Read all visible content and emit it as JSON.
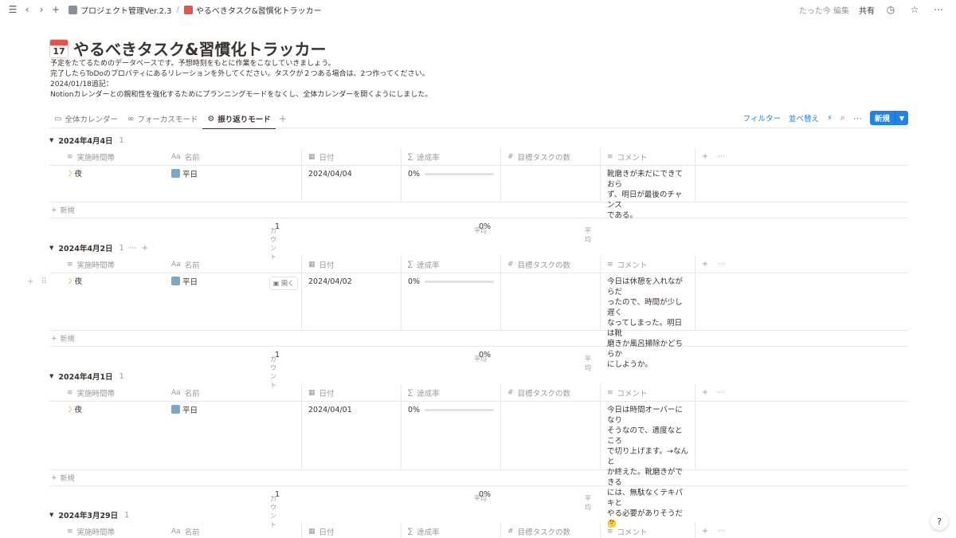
{
  "breadcrumb": {
    "parent": "プロジェクト管理Ver.2.3",
    "current": "やるべきタスク&習慣化トラッカー",
    "separator": "/"
  },
  "topbar": {
    "edited": "たった今 編集",
    "share": "共有"
  },
  "page": {
    "title": "やるべきタスク&習慣化トラッカー",
    "icon_day": "17",
    "description": [
      "予定をたてるためのデータベースです。予想時刻をもとに作業をこなしていきましょう。",
      "完了したらToDoのプロパティにあるリレーションを外してください。タスクが２つある場合は、2つ作ってください。",
      "2024/01/18追記：",
      "Notionカレンダーとの親和性を強化するためにプランニングモードをなくし、全体カレンダーを開くようにしました。"
    ]
  },
  "views": [
    {
      "label": "全体カレンダー",
      "icon": "calendar-icon"
    },
    {
      "label": "フォーカスモード",
      "icon": "glasses-icon"
    },
    {
      "label": "振り返りモード",
      "icon": "gear-icon"
    }
  ],
  "toolbar": {
    "filter": "フィルター",
    "sort": "並べ替え",
    "new": "新規"
  },
  "columns": {
    "time": "実施時間帯",
    "name": "名前",
    "date": "日付",
    "rate": "達成率",
    "goal": "目標タスクの数",
    "comment": "コメント"
  },
  "labels": {
    "new_row": "新規",
    "count": "カウント",
    "avg": "平均",
    "open": "開く"
  },
  "groups": [
    {
      "title": "2024年4月4日",
      "count": "1",
      "row": {
        "time": "夜",
        "name": "平日",
        "date": "2024/04/04",
        "rate": "0%",
        "rate_value": 0,
        "comment": [
          "靴磨きが未だにできておら",
          "ず、明日が最後のチャンス",
          "である。"
        ]
      },
      "calc": {
        "count": "1",
        "avg": "0%"
      }
    },
    {
      "title": "2024年4月2日",
      "count": "1",
      "row": {
        "time": "夜",
        "name": "平日",
        "date": "2024/04/02",
        "rate": "0%",
        "rate_value": 0,
        "comment": [
          "今日は休憩を入れながらだ",
          "ったので、時間が少し遅く",
          "なってしまった。明日は靴",
          "磨きか風呂掃除かどちらか",
          "にしようか。"
        ]
      },
      "calc": {
        "count": "1",
        "avg": "0%"
      }
    },
    {
      "title": "2024年4月1日",
      "count": "1",
      "row": {
        "time": "夜",
        "name": "平日",
        "date": "2024/04/01",
        "rate": "0%",
        "rate_value": 0,
        "comment": [
          "今日は時間オーバーになり",
          "そうなので、適度なところ",
          "で切り上げます。→なんと",
          "か終えた。靴磨きができる",
          "には、無駄なくテキパキと",
          "やる必要がありそうだ🤔"
        ]
      },
      "calc": {
        "count": "1",
        "avg": "0%"
      }
    },
    {
      "title": "2024年3月29日",
      "count": "1"
    }
  ],
  "help": "?"
}
